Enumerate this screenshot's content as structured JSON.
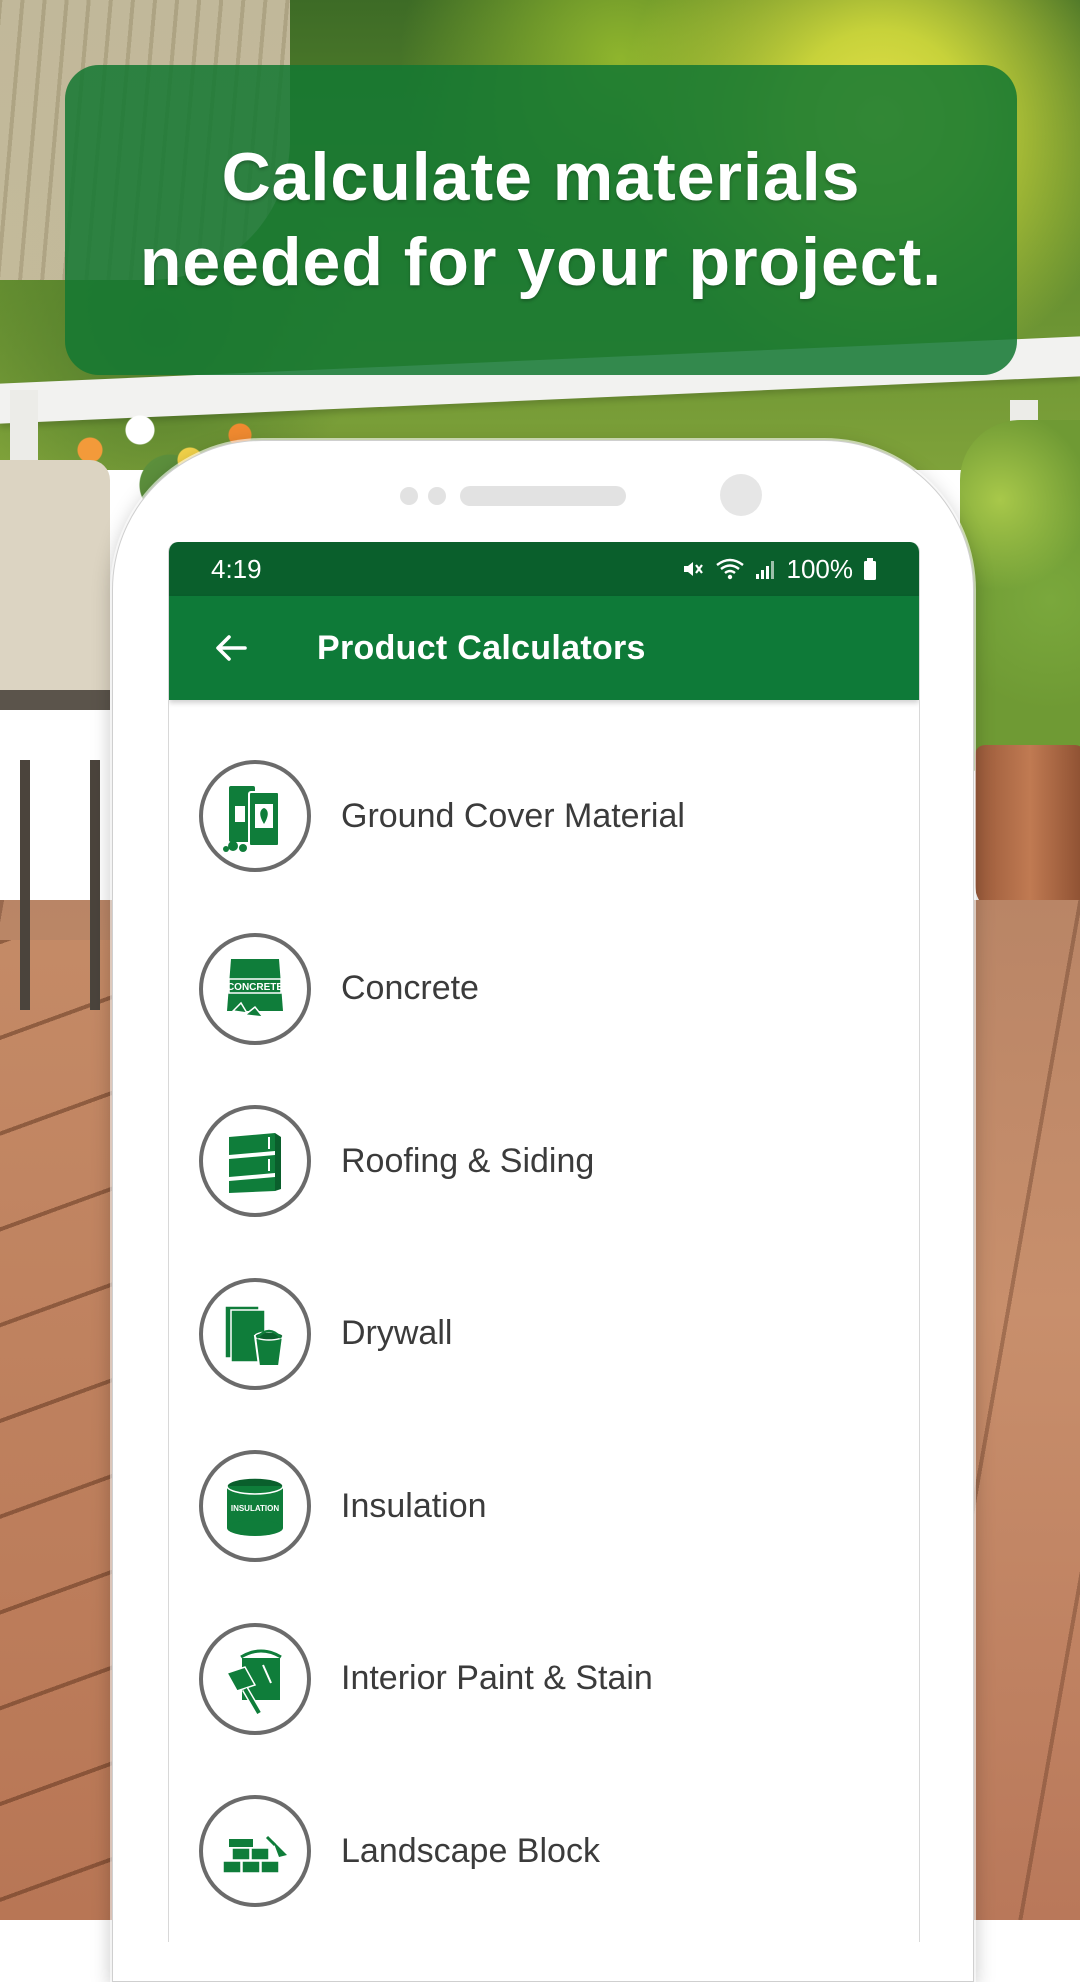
{
  "headline": {
    "line1": "Calculate materials",
    "line2": "needed for your project."
  },
  "status_bar": {
    "time": "4:19",
    "battery": "100%",
    "icons": [
      "mute-icon",
      "wifi-icon",
      "signal-icon",
      "battery-icon"
    ]
  },
  "app_bar": {
    "back_icon": "arrow-left-icon",
    "title": "Product Calculators"
  },
  "calculators": [
    {
      "label": "Ground Cover Material",
      "icon": "ground-cover-bag-icon"
    },
    {
      "label": "Concrete",
      "icon": "concrete-bag-icon",
      "icon_text": "CONCRETE"
    },
    {
      "label": "Roofing & Siding",
      "icon": "siding-panels-icon"
    },
    {
      "label": "Drywall",
      "icon": "drywall-bucket-icon"
    },
    {
      "label": "Insulation",
      "icon": "insulation-roll-icon",
      "icon_text": "INSULATION"
    },
    {
      "label": "Interior Paint & Stain",
      "icon": "paint-brush-icon"
    },
    {
      "label": "Landscape Block",
      "icon": "landscape-block-icon"
    }
  ],
  "colors": {
    "brand_green": "#0e7a38",
    "status_green": "#0a5f2c",
    "banner_green": "#147832",
    "icon_green": "#0f7d3a"
  }
}
